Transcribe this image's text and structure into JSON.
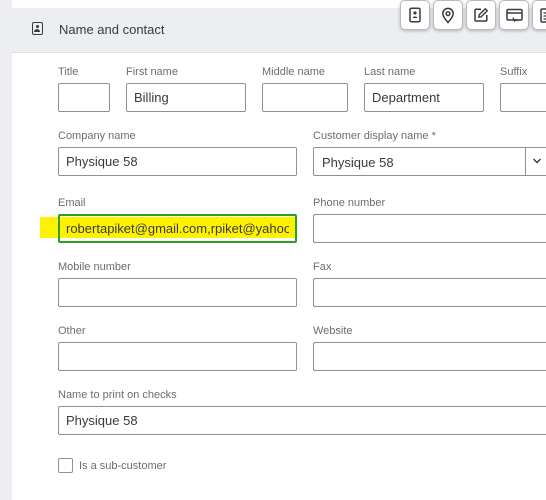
{
  "section": {
    "title": "Name and contact",
    "icon": "person-card-icon"
  },
  "toolbar_icons": [
    "contact-card-icon",
    "location-pin-icon",
    "edit-note-icon",
    "payments-icon",
    "list-icon"
  ],
  "fields": {
    "title": {
      "label": "Title",
      "value": ""
    },
    "first_name": {
      "label": "First name",
      "value": "Billing"
    },
    "middle_name": {
      "label": "Middle name",
      "value": ""
    },
    "last_name": {
      "label": "Last name",
      "value": "Department"
    },
    "suffix": {
      "label": "Suffix",
      "value": ""
    },
    "company_name": {
      "label": "Company name",
      "value": "Physique 58"
    },
    "display_name": {
      "label": "Customer display name *",
      "value": "Physique 58"
    },
    "email": {
      "label": "Email",
      "value": "robertapiket@gmail.com,rpiket@yahoo.com"
    },
    "phone": {
      "label": "Phone number",
      "value": ""
    },
    "mobile": {
      "label": "Mobile number",
      "value": ""
    },
    "fax": {
      "label": "Fax",
      "value": ""
    },
    "other": {
      "label": "Other",
      "value": ""
    },
    "website": {
      "label": "Website",
      "value": ""
    },
    "print_name": {
      "label": "Name to print on checks",
      "value": "Physique 58"
    }
  },
  "sub_customer": {
    "label": "Is a sub-customer",
    "checked": false
  },
  "colors": {
    "focus_border": "#2ca01c",
    "highlight": "#fff200",
    "header_bg": "#eceef1",
    "label_text": "#6b6c72",
    "value_text": "#393a3d"
  }
}
